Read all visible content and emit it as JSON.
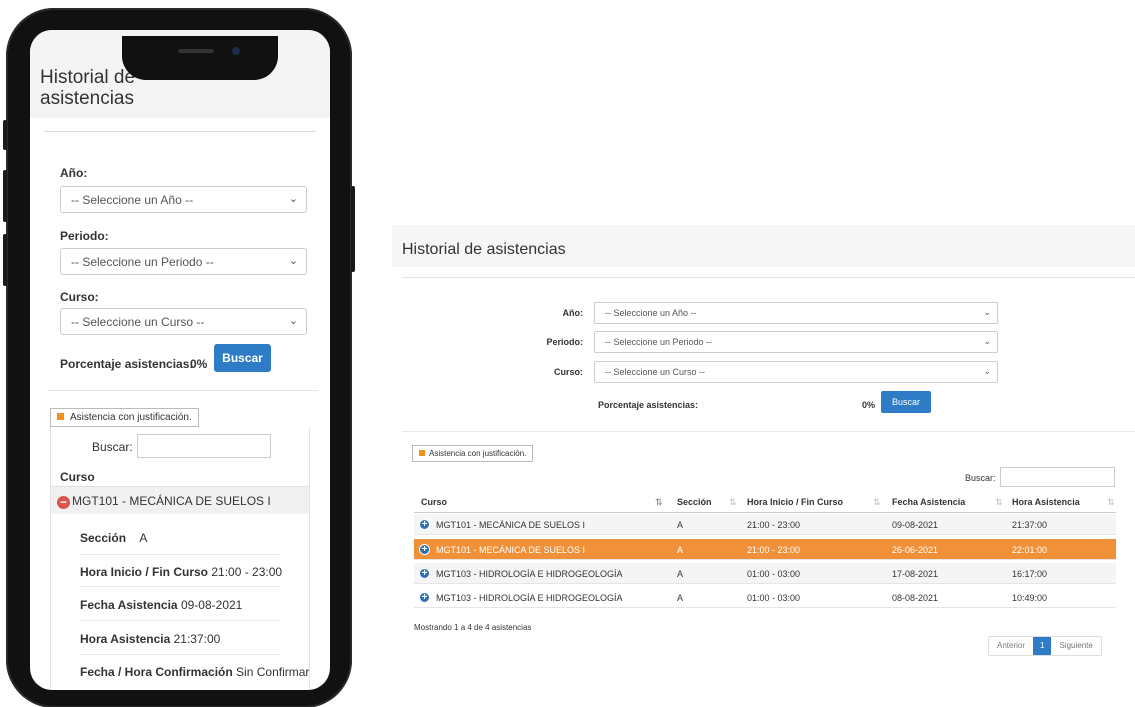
{
  "title": "Historial de asistencias",
  "mobile_title": "Historial de asistencias",
  "filters": {
    "anio_label": "Año:",
    "anio_value": "-- Seleccione un Año --",
    "periodo_label": "Periodo:",
    "periodo_value": "-- Seleccione un Periodo --",
    "curso_label": "Curso:",
    "curso_value": "-- Seleccione un Curso --",
    "porcentaje_label": "Porcentaje asistencias:",
    "porcentaje_value": "0%",
    "buscar_button": "Buscar"
  },
  "legend": "Asistencia con justificación.",
  "search_label": "Buscar:",
  "table": {
    "columns": [
      "Curso",
      "Sección",
      "Hora Inicio / Fin Curso",
      "Fecha Asistencia",
      "Hora Asistencia"
    ],
    "rows": [
      {
        "curso": "MGT101 - MECÁNICA DE SUELOS I",
        "seccion": "A",
        "hora": "21:00 - 23:00",
        "fecha": "09-08-2021",
        "hora_asistencia": "21:37:00",
        "justificada": false
      },
      {
        "curso": "MGT101 - MECÁNICA DE SUELOS I",
        "seccion": "A",
        "hora": "21:00 - 23:00",
        "fecha": "26-06-2021",
        "hora_asistencia": "22:01:00",
        "justificada": true
      },
      {
        "curso": "MGT103 - HIDROLOGÍA E HIDROGEOLOGÍA",
        "seccion": "A",
        "hora": "01:00 - 03:00",
        "fecha": "17-08-2021",
        "hora_asistencia": "16:17:00",
        "justificada": false
      },
      {
        "curso": "MGT103 - HIDROLOGÍA E HIDROGEOLOGÍA",
        "seccion": "A",
        "hora": "01:00 - 03:00",
        "fecha": "08-08-2021",
        "hora_asistencia": "10:49:00",
        "justificada": false
      }
    ],
    "info": "Mostrando 1 a 4 de 4 asistencias"
  },
  "pagination": {
    "prev": "Anterior",
    "page": "1",
    "next": "Siguiente"
  },
  "mobile_detail": {
    "curso_header": "Curso",
    "row_label": "MGT101 - MECÁNICA DE SUELOS I",
    "seccion_label": "Sección",
    "seccion_value": "A",
    "hora_label": "Hora Inicio / Fin Curso",
    "hora_value": "21:00 - 23:00",
    "fecha_label": "Fecha Asistencia",
    "fecha_value": "09-08-2021",
    "hora_asist_label": "Hora Asistencia",
    "hora_asist_value": "21:37:00",
    "confirm_label": "Fecha / Hora Confirmación",
    "confirm_value": "Sin Confirmar"
  },
  "colors": {
    "accent": "#2e7cc6",
    "highlight": "#f0913a",
    "justified": "#f5901e"
  }
}
